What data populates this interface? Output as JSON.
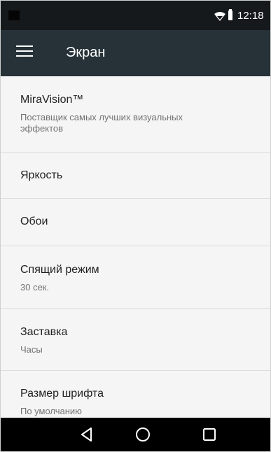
{
  "status_bar": {
    "time": "12:18",
    "icons": [
      "notification-icon",
      "wifi-icon",
      "battery-icon"
    ]
  },
  "app_bar": {
    "menu_icon": "menu-icon",
    "title": "Экран"
  },
  "settings": [
    {
      "title": "MiraVision™",
      "summary_lines": [
        "Поставщик самых лучших визуальных",
        "эффектов"
      ]
    },
    {
      "title": "Яркость"
    },
    {
      "title": "Обои"
    },
    {
      "title": "Спящий режим",
      "summary": "30 сек."
    },
    {
      "title": "Заставка",
      "summary": "Часы"
    },
    {
      "title": "Размер шрифта",
      "summary": "По умолчанию"
    }
  ],
  "nav_bar": {
    "buttons": [
      "back-icon",
      "home-icon",
      "recents-icon"
    ]
  },
  "colors": {
    "status_bar": "#15191c",
    "app_bar": "#263238",
    "list_background": "#f5f5f5",
    "divider": "#dcdcdc",
    "nav_bar": "#000000"
  }
}
